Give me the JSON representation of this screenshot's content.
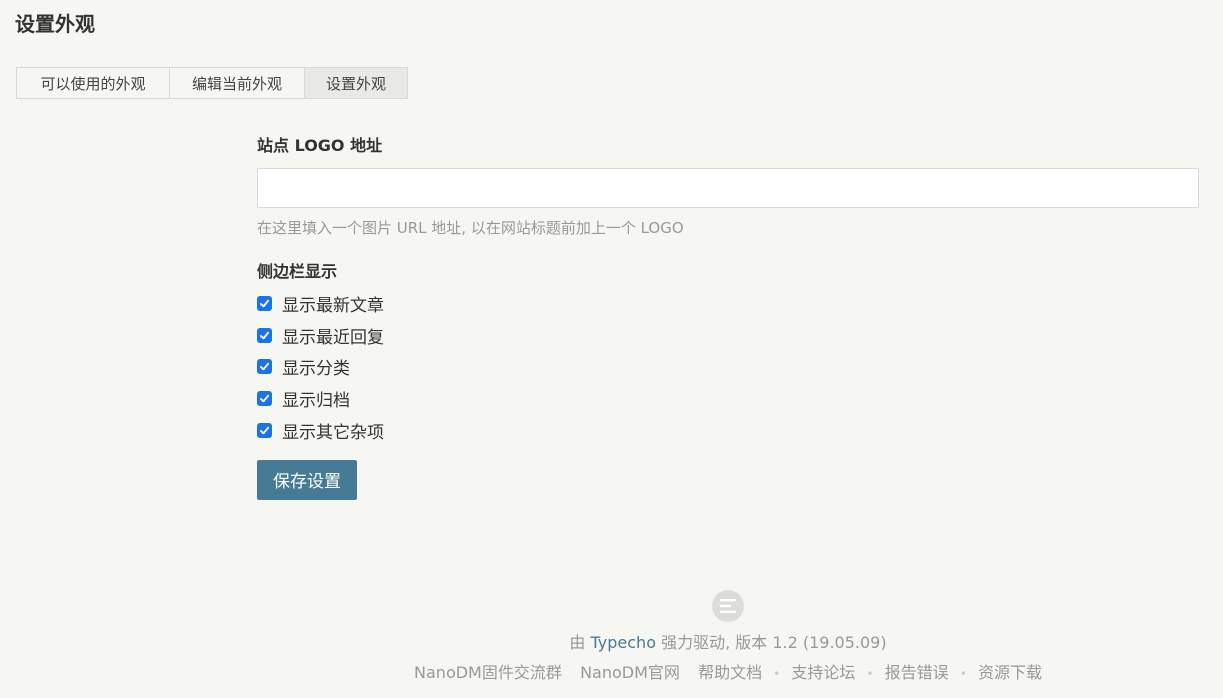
{
  "page": {
    "title": "设置外观"
  },
  "tabs": [
    {
      "label": "可以使用的外观"
    },
    {
      "label": "编辑当前外观"
    },
    {
      "label": "设置外观",
      "active": true
    }
  ],
  "form": {
    "logo": {
      "label": "站点 LOGO 地址",
      "value": "",
      "hint": "在这里填入一个图片 URL 地址, 以在网站标题前加上一个 LOGO"
    },
    "sidebar": {
      "label": "侧边栏显示",
      "options": [
        {
          "label": "显示最新文章",
          "checked": true
        },
        {
          "label": "显示最近回复",
          "checked": true
        },
        {
          "label": "显示分类",
          "checked": true
        },
        {
          "label": "显示归档",
          "checked": true
        },
        {
          "label": "显示其它杂项",
          "checked": true
        }
      ]
    },
    "save_label": "保存设置"
  },
  "footer": {
    "logo_icon": "typecho-logo-icon",
    "powered_prefix": "由",
    "powered_link": "Typecho",
    "powered_suffix": "强力驱动, 版本 1.2 (19.05.09)",
    "links": [
      "NanoDM固件交流群",
      "NanoDM官网",
      "帮助文档",
      "支持论坛",
      "报告错误",
      "资源下载"
    ]
  },
  "colors": {
    "accent": "#467b96",
    "checkbox": "#1a73e8",
    "background": "#f6f6f3"
  }
}
